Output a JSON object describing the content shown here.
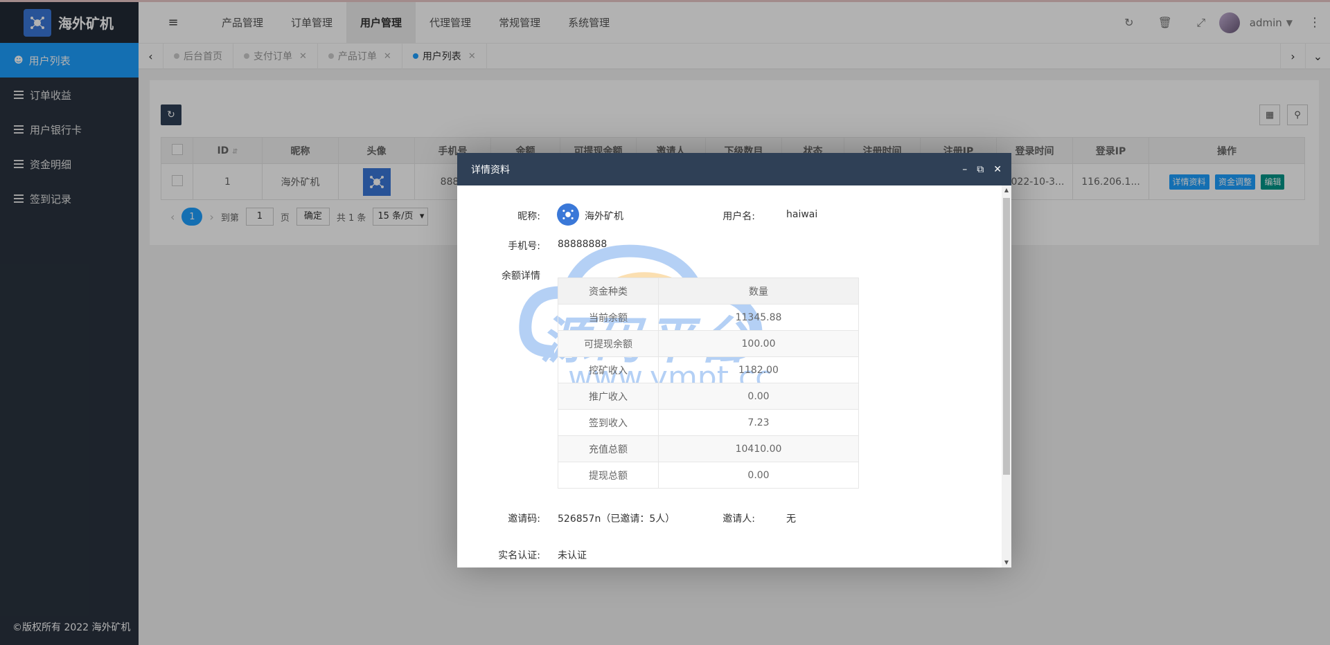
{
  "brand": {
    "title": "海外矿机"
  },
  "sidebar": {
    "items": [
      {
        "label": "用户列表",
        "active": true
      },
      {
        "label": "订单收益",
        "active": false
      },
      {
        "label": "用户银行卡",
        "active": false
      },
      {
        "label": "资金明细",
        "active": false
      },
      {
        "label": "签到记录",
        "active": false
      }
    ],
    "copyright": "©版权所有 2022 海外矿机"
  },
  "topbar": {
    "menu": [
      "产品管理",
      "订单管理",
      "用户管理",
      "代理管理",
      "常规管理",
      "系统管理"
    ],
    "active_menu": "用户管理",
    "user": "admin"
  },
  "tabs": [
    {
      "label": "后台首页",
      "closable": false
    },
    {
      "label": "支付订单",
      "closable": true
    },
    {
      "label": "产品订单",
      "closable": true
    },
    {
      "label": "用户列表",
      "closable": true,
      "active": true
    }
  ],
  "table": {
    "headers": [
      "ID",
      "昵称",
      "头像",
      "手机号",
      "余额",
      "可提现余额",
      "邀请人",
      "下级数目",
      "状态",
      "注册时间",
      "注册IP",
      "登录时间",
      "登录IP",
      "操作"
    ],
    "row": {
      "id": "1",
      "nickname": "海外矿机",
      "phone": "8888",
      "login_time": "2022-10-3...",
      "login_ip": "116.206.1...",
      "actions": [
        "详情资料",
        "资金调整",
        "编辑"
      ]
    }
  },
  "pager": {
    "current": "1",
    "goto_label": "到第",
    "page_value": "1",
    "page_unit": "页",
    "confirm": "确定",
    "total": "共 1 条",
    "per_page": "15 条/页"
  },
  "modal": {
    "title": "详情资料",
    "nickname_label": "昵称:",
    "nickname": "海外矿机",
    "username_label": "用户名:",
    "username": "haiwai",
    "phone_label": "手机号:",
    "phone": "88888888",
    "balance_label": "余额详情",
    "balance_headers": [
      "资金种类",
      "数量"
    ],
    "balance_rows": [
      [
        "当前余额",
        "11345.88"
      ],
      [
        "可提现余额",
        "100.00"
      ],
      [
        "挖矿收入",
        "1182.00"
      ],
      [
        "推广收入",
        "0.00"
      ],
      [
        "签到收入",
        "7.23"
      ],
      [
        "充值总额",
        "10410.00"
      ],
      [
        "提现总额",
        "0.00"
      ]
    ],
    "invite_code_label": "邀请码:",
    "invite_code": "526857n（已邀请：5人）",
    "inviter_label": "邀请人:",
    "inviter": "无",
    "realname_label": "实名认证:",
    "realname": "未认证"
  },
  "watermark": {
    "text": "源码平台",
    "url": "www.ympt.cc"
  }
}
